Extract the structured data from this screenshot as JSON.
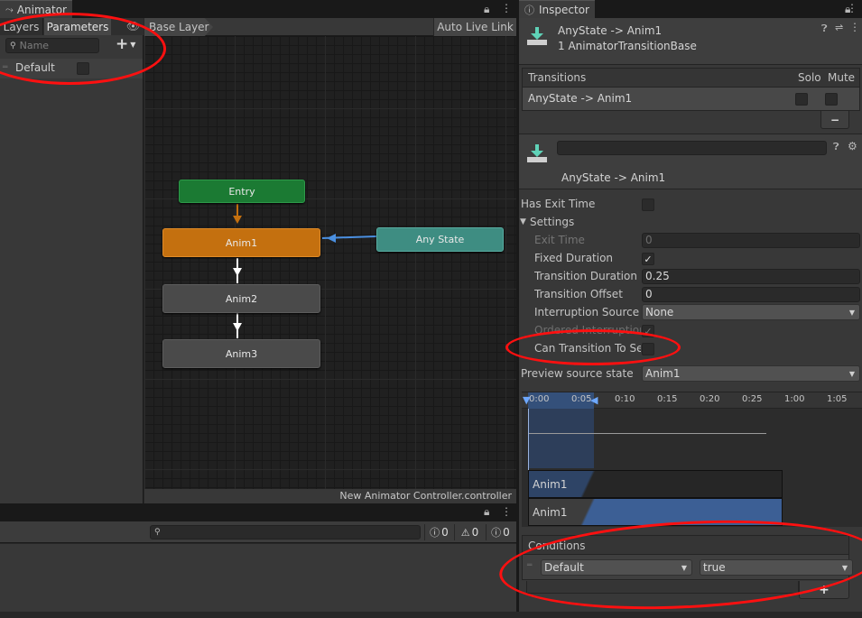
{
  "animator": {
    "title": "Animator",
    "tabs": [
      "Layers",
      "Parameters"
    ],
    "search_placeholder": "Name",
    "add_symbol": "+",
    "parameters": [
      {
        "name": "Default"
      }
    ],
    "breadcrumb": "Base Layer",
    "auto_live_link": "Auto Live Link",
    "footer_path": "New Animator Controller.controller",
    "nodes": {
      "entry": "Entry",
      "anim1": "Anim1",
      "anim2": "Anim2",
      "anim3": "Anim3",
      "any_state": "Any State"
    }
  },
  "console": {
    "info_count": "0",
    "warning_count": "0",
    "error_count": "0"
  },
  "inspector": {
    "title": "Inspector",
    "header_title": "AnyState -> Anim1",
    "header_subtitle": "1 AnimatorTransitionBase",
    "transitions_header": "Transitions",
    "solo_label": "Solo",
    "mute_label": "Mute",
    "transition_row": "AnyState -> Anim1",
    "minus_symbol": "−",
    "transition_name_value": "",
    "transition_subtitle": "AnyState -> Anim1",
    "has_exit_time_label": "Has Exit Time",
    "settings_label": "Settings",
    "exit_time_label": "Exit Time",
    "exit_time_value": "0",
    "fixed_duration_label": "Fixed Duration",
    "transition_duration_label": "Transition Duration (s",
    "transition_duration_value": "0.25",
    "transition_offset_label": "Transition Offset",
    "transition_offset_value": "0",
    "interruption_source_label": "Interruption Source",
    "interruption_source_value": "None",
    "ordered_interruption_label": "Ordered Interruption",
    "can_transition_label": "Can Transition To Se",
    "preview_source_label": "Preview source state",
    "preview_source_value": "Anim1",
    "timeline_ticks": [
      "0:00",
      "0:05",
      "0:10",
      "0:15",
      "0:20",
      "0:25",
      "1:00",
      "1:05"
    ],
    "track_labels": [
      "Anim1",
      "Anim1"
    ],
    "conditions_label": "Conditions",
    "condition_param": "Default",
    "condition_value": "true",
    "add_symbol": "+"
  },
  "colors": {
    "entry": "#1b7a33",
    "anim1": "#c4700f",
    "state": "#4a4a4a",
    "any_state": "#3e8d82",
    "annotation": "#ff1010",
    "transition_arrow": "#4a8fe0"
  }
}
